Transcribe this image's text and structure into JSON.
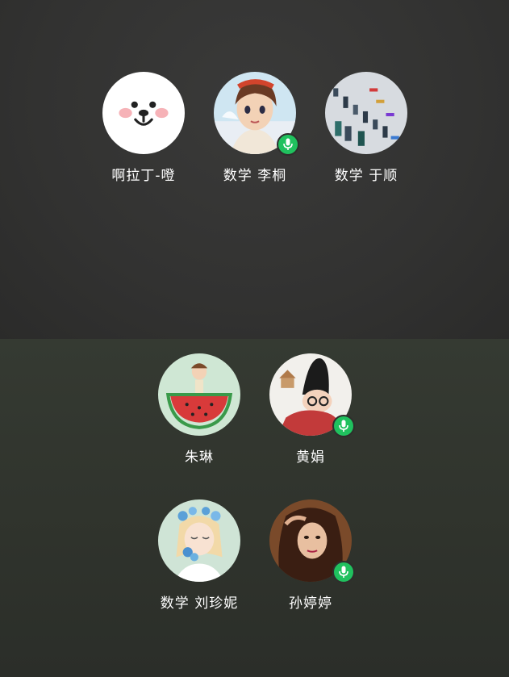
{
  "members": [
    {
      "name": "啊拉丁-噔",
      "avatar_icon": "bunny-face-icon",
      "speaking": false
    },
    {
      "name": "数学 李桐",
      "avatar_icon": "anime-girl-icon",
      "speaking": true
    },
    {
      "name": "数学 于顺",
      "avatar_icon": "chart-photo-icon",
      "speaking": false
    },
    {
      "name": "朱琳",
      "avatar_icon": "watermelon-girl-icon",
      "speaking": false
    },
    {
      "name": "黄娟",
      "avatar_icon": "baby-photo-icon",
      "speaking": true
    },
    {
      "name": "数学 刘珍妮",
      "avatar_icon": "flower-girl-icon",
      "speaking": false
    },
    {
      "name": "孙婷婷",
      "avatar_icon": "woman-photo-icon",
      "speaking": true
    }
  ],
  "colors": {
    "mic_badge": "#20c15e",
    "name_text": "#ffffff"
  }
}
